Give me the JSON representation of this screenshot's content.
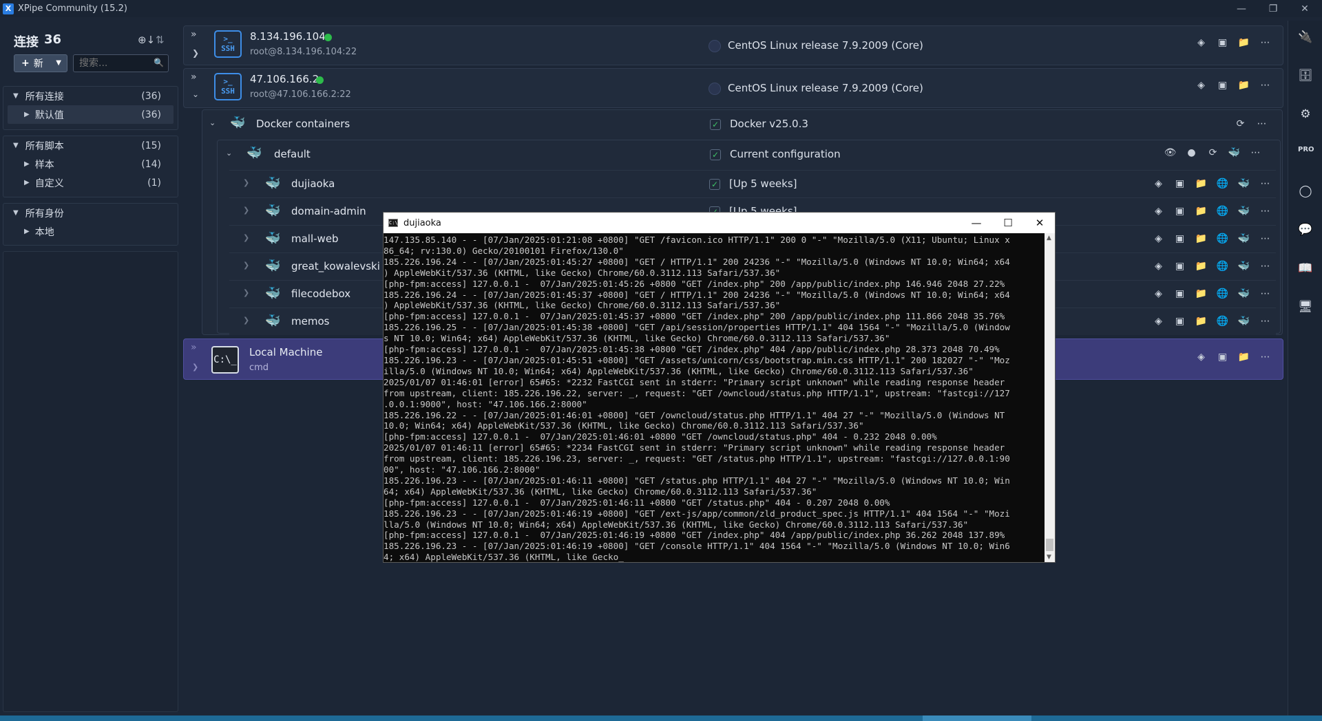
{
  "app": {
    "title": "XPipe Community (15.2)"
  },
  "sidebar": {
    "title": "连接",
    "count": "36",
    "new_label": "新",
    "search_placeholder": "搜索...",
    "groups": [
      {
        "label": "所有连接",
        "count": "(36)",
        "children": [
          {
            "label": "默认值",
            "count": "(36)",
            "selected": true
          }
        ]
      },
      {
        "label": "所有脚本",
        "count": "(15)",
        "children": [
          {
            "label": "样本",
            "count": "(14)"
          },
          {
            "label": "自定义",
            "count": "(1)"
          }
        ]
      },
      {
        "label": "所有身份",
        "count": "",
        "children": [
          {
            "label": "本地",
            "count": ""
          }
        ]
      }
    ]
  },
  "hosts": [
    {
      "name": "8.134.196.104",
      "address": "root@8.134.196.104:22",
      "os": "CentOS Linux release 7.9.2009 (Core)",
      "online": true,
      "icon": "ssh-icon"
    },
    {
      "name": "47.106.166.2",
      "address": "root@47.106.166.2:22",
      "os": "CentOS Linux release 7.9.2009 (Core)",
      "online": true,
      "icon": "ssh-icon"
    }
  ],
  "docker": {
    "name": "Docker containers",
    "version": "Docker v25.0.3",
    "context": {
      "name": "default",
      "status": "Current configuration"
    },
    "containers": [
      {
        "name": "dujiaoka",
        "status": "[Up 5 weeks]"
      },
      {
        "name": "domain-admin",
        "status": "[Up 5 weeks]"
      },
      {
        "name": "mall-web",
        "status": ""
      },
      {
        "name": "great_kowalevski",
        "status": ""
      },
      {
        "name": "filecodebox",
        "status": ""
      },
      {
        "name": "memos",
        "status": ""
      }
    ]
  },
  "local": {
    "name": "Local Machine",
    "shell": "cmd",
    "icon_text": "C:\\_"
  },
  "terminal": {
    "title": "dujiaoka",
    "icon_text": "C:\\",
    "lines": [
      "147.135.85.140 - - [07/Jan/2025:01:21:08 +0800] \"GET /favicon.ico HTTP/1.1\" 200 0 \"-\" \"Mozilla/5.0 (X11; Ubuntu; Linux x",
      "86_64; rv:130.0) Gecko/20100101 Firefox/130.0\"",
      "185.226.196.24 - - [07/Jan/2025:01:45:27 +0800] \"GET / HTTP/1.1\" 200 24236 \"-\" \"Mozilla/5.0 (Windows NT 10.0; Win64; x64",
      ") AppleWebKit/537.36 (KHTML, like Gecko) Chrome/60.0.3112.113 Safari/537.36\"",
      "[php-fpm:access] 127.0.0.1 -  07/Jan/2025:01:45:26 +0800 \"GET /index.php\" 200 /app/public/index.php 146.946 2048 27.22%",
      "185.226.196.24 - - [07/Jan/2025:01:45:37 +0800] \"GET / HTTP/1.1\" 200 24236 \"-\" \"Mozilla/5.0 (Windows NT 10.0; Win64; x64",
      ") AppleWebKit/537.36 (KHTML, like Gecko) Chrome/60.0.3112.113 Safari/537.36\"",
      "[php-fpm:access] 127.0.0.1 -  07/Jan/2025:01:45:37 +0800 \"GET /index.php\" 200 /app/public/index.php 111.866 2048 35.76%",
      "185.226.196.25 - - [07/Jan/2025:01:45:38 +0800] \"GET /api/session/properties HTTP/1.1\" 404 1564 \"-\" \"Mozilla/5.0 (Window",
      "s NT 10.0; Win64; x64) AppleWebKit/537.36 (KHTML, like Gecko) Chrome/60.0.3112.113 Safari/537.36\"",
      "[php-fpm:access] 127.0.0.1 -  07/Jan/2025:01:45:38 +0800 \"GET /index.php\" 404 /app/public/index.php 28.373 2048 70.49%",
      "185.226.196.23 - - [07/Jan/2025:01:45:51 +0800] \"GET /assets/unicorn/css/bootstrap.min.css HTTP/1.1\" 200 182027 \"-\" \"Moz",
      "illa/5.0 (Windows NT 10.0; Win64; x64) AppleWebKit/537.36 (KHTML, like Gecko) Chrome/60.0.3112.113 Safari/537.36\"",
      "2025/01/07 01:46:01 [error] 65#65: *2232 FastCGI sent in stderr: \"Primary script unknown\" while reading response header",
      "from upstream, client: 185.226.196.22, server: _, request: \"GET /owncloud/status.php HTTP/1.1\", upstream: \"fastcgi://127",
      ".0.0.1:9000\", host: \"47.106.166.2:8000\"",
      "185.226.196.22 - - [07/Jan/2025:01:46:01 +0800] \"GET /owncloud/status.php HTTP/1.1\" 404 27 \"-\" \"Mozilla/5.0 (Windows NT",
      "10.0; Win64; x64) AppleWebKit/537.36 (KHTML, like Gecko) Chrome/60.0.3112.113 Safari/537.36\"",
      "[php-fpm:access] 127.0.0.1 -  07/Jan/2025:01:46:01 +0800 \"GET /owncloud/status.php\" 404 - 0.232 2048 0.00%",
      "2025/01/07 01:46:11 [error] 65#65: *2234 FastCGI sent in stderr: \"Primary script unknown\" while reading response header",
      "from upstream, client: 185.226.196.23, server: _, request: \"GET /status.php HTTP/1.1\", upstream: \"fastcgi://127.0.0.1:90",
      "00\", host: \"47.106.166.2:8000\"",
      "185.226.196.23 - - [07/Jan/2025:01:46:11 +0800] \"GET /status.php HTTP/1.1\" 404 27 \"-\" \"Mozilla/5.0 (Windows NT 10.0; Win",
      "64; x64) AppleWebKit/537.36 (KHTML, like Gecko) Chrome/60.0.3112.113 Safari/537.36\"",
      "[php-fpm:access] 127.0.0.1 -  07/Jan/2025:01:46:11 +0800 \"GET /status.php\" 404 - 0.207 2048 0.00%",
      "185.226.196.23 - - [07/Jan/2025:01:46:19 +0800] \"GET /ext-js/app/common/zld_product_spec.js HTTP/1.1\" 404 1564 \"-\" \"Mozi",
      "lla/5.0 (Windows NT 10.0; Win64; x64) AppleWebKit/537.36 (KHTML, like Gecko) Chrome/60.0.3112.113 Safari/537.36\"",
      "[php-fpm:access] 127.0.0.1 -  07/Jan/2025:01:46:19 +0800 \"GET /index.php\" 404 /app/public/index.php 36.262 2048 137.89%",
      "185.226.196.23 - - [07/Jan/2025:01:46:19 +0800] \"GET /console HTTP/1.1\" 404 1564 \"-\" \"Mozilla/5.0 (Windows NT 10.0; Win6",
      "4; x64) AppleWebKit/537.36 (KHTML, like Gecko_"
    ]
  },
  "colors": {
    "accent": "#3c95ec",
    "online": "#2dbb4b",
    "selected_row": "#3c3c7a"
  }
}
